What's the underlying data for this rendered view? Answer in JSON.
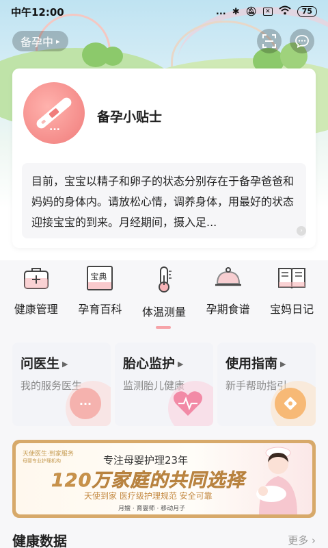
{
  "status_bar": {
    "time": "中午12:00",
    "signal_dots": "...",
    "battery": "75"
  },
  "header": {
    "stage_label": "备孕中",
    "stage_arrow": "▸"
  },
  "tips_card": {
    "title": "备孕小贴士",
    "image_dots": "...",
    "body": "目前，宝宝以精子和卵子的状态分别存在于备孕爸爸和妈妈的身体内。请放松心情，调养身体，用最好的状态迎接宝宝的到来。月经期间，摄入足..."
  },
  "tools": [
    {
      "label": "健康管理",
      "icon": "medkit-icon"
    },
    {
      "label": "孕育百科",
      "icon": "book-icon",
      "icon_text": "宝典"
    },
    {
      "label": "体温测量",
      "icon": "thermometer-icon"
    },
    {
      "label": "孕期食谱",
      "icon": "cloche-icon"
    },
    {
      "label": "宝妈日记",
      "icon": "diary-icon"
    }
  ],
  "services": [
    {
      "title": "问医生",
      "subtitle": "我的服务医生",
      "icon": "chat-bubble-icon",
      "color": "#f3a6a2"
    },
    {
      "title": "胎心监护",
      "subtitle": "监测胎儿健康",
      "icon": "heartbeat-icon",
      "color": "#f07c98"
    },
    {
      "title": "使用指南",
      "subtitle": "新手帮助指引",
      "icon": "compass-icon",
      "color": "#f5b06b"
    }
  ],
  "banner": {
    "brand": "天使医生·到家服务",
    "brand_sub": "母婴专业护理机构",
    "line1": "专注母婴护理23年",
    "line2": "120万家庭的共同选择",
    "line3": "天使到家  医疗级护理规范  安全可靠",
    "line4": "月嫂 · 育婴师 · 移动月子"
  },
  "health_section": {
    "title": "健康数据",
    "more": "更多"
  },
  "colors": {
    "accent_pink": "#f07c7b",
    "banner_gold": "#d7a96a",
    "card_bg": "#f3f4f8"
  }
}
